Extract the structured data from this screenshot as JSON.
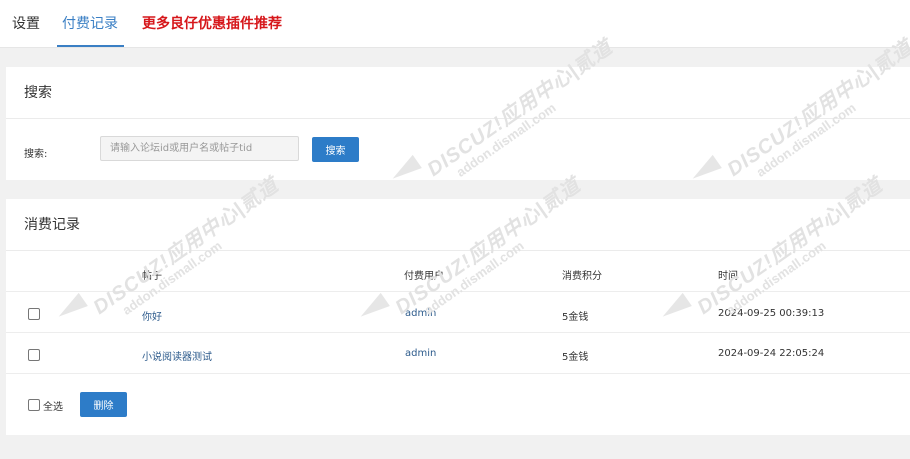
{
  "nav": {
    "tabs": [
      {
        "label": "设置"
      },
      {
        "label": "付费记录"
      },
      {
        "label": "更多良仔优惠插件推荐"
      }
    ]
  },
  "search": {
    "title": "搜索",
    "label": "搜索:",
    "placeholder": "请输入论坛id或用户名或帖子tid",
    "button": "搜索"
  },
  "records": {
    "title": "消费记录",
    "columns": [
      "帖子",
      "付费用户",
      "消费积分",
      "时间"
    ],
    "rows": [
      {
        "post": "你好",
        "user": "admin",
        "points": "5金钱",
        "time": "2024-09-25 00:39:13"
      },
      {
        "post": "小说阅读器测试",
        "user": "admin",
        "points": "5金钱",
        "time": "2024-09-24 22:05:24"
      }
    ],
    "select_all": "全选",
    "delete_button": "删除"
  },
  "watermark": {
    "main": "DISCUZ!应用中心|贰道",
    "sub": "addon.dismall.com"
  },
  "colors": {
    "accent": "#2d7cc8",
    "active_tab": "#3a7fc4",
    "promo": "#d6171b",
    "link": "#2d5b8c"
  }
}
